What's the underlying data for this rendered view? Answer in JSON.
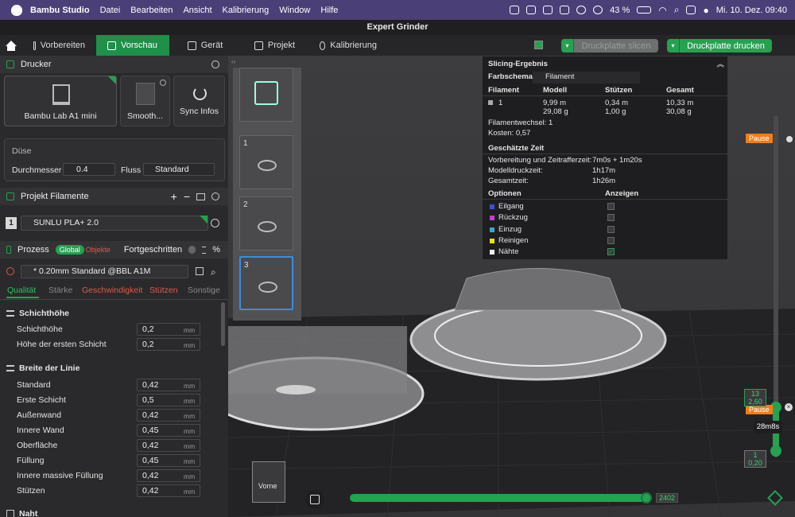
{
  "menubar": {
    "app": "Bambu Studio",
    "items": [
      "Datei",
      "Bearbeiten",
      "Ansicht",
      "Kalibrierung",
      "Window",
      "Hilfe"
    ],
    "battery": "43 %",
    "clock": "Mi. 10. Dez.  09:40"
  },
  "window": {
    "title": "Expert Grinder"
  },
  "tabs": {
    "prepare": "Vorbereiten",
    "preview": "Vorschau",
    "device": "Gerät",
    "project": "Projekt",
    "calibration": "Kalibrierung"
  },
  "actions": {
    "slice": "Druckplatte slicen",
    "print": "Druckplatte drucken"
  },
  "printer": {
    "header": "Drucker",
    "name": "Bambu Lab A1 mini",
    "plate": "Smooth...",
    "sync": "Sync Infos",
    "nozzle_label": "Düse",
    "diameter_label": "Durchmesser",
    "diameter": "0.4",
    "flow_label": "Fluss",
    "flow": "Standard"
  },
  "filament": {
    "header": "Projekt Filamente",
    "index": "1",
    "name": "SUNLU PLA+ 2.0"
  },
  "process": {
    "header": "Prozess",
    "global": "Global",
    "objects": "Objekte",
    "advanced": "Fortgeschritten",
    "preset": "* 0.20mm Standard @BBL A1M"
  },
  "subtabs": [
    "Qualität",
    "Stärke",
    "Geschwindigkeit",
    "Stützen",
    "Sonstige"
  ],
  "groups": {
    "layer_height": "Schichthöhe",
    "line_width": "Breite der Linie",
    "seam": "Naht"
  },
  "layer_rows": [
    {
      "label": "Schichthöhe",
      "value": "0,2",
      "unit": "mm"
    },
    {
      "label": "Höhe der ersten Schicht",
      "value": "0,2",
      "unit": "mm"
    }
  ],
  "width_rows": [
    {
      "label": "Standard",
      "value": "0,42",
      "unit": "mm"
    },
    {
      "label": "Erste Schicht",
      "value": "0,5",
      "unit": "mm"
    },
    {
      "label": "Außenwand",
      "value": "0,42",
      "unit": "mm"
    },
    {
      "label": "Innere Wand",
      "value": "0,45",
      "unit": "mm"
    },
    {
      "label": "Oberfläche",
      "value": "0,42",
      "unit": "mm"
    },
    {
      "label": "Füllung",
      "value": "0,45",
      "unit": "mm"
    },
    {
      "label": "Innere massive Füllung",
      "value": "0,42",
      "unit": "mm"
    },
    {
      "label": "Stützen",
      "value": "0,42",
      "unit": "mm"
    }
  ],
  "thumbs": [
    "1",
    "2",
    "3"
  ],
  "result": {
    "title": "Slicing-Ergebnis",
    "scheme_label": "Farbschema",
    "scheme": "Filament",
    "cols": [
      "Filament",
      "Modell",
      "Stützen",
      "Gesamt"
    ],
    "row": {
      "id": "1",
      "model_m": "9,99 m",
      "model_g": "29,08 g",
      "support_m": "0,34 m",
      "support_g": "1,00 g",
      "total_m": "10,33 m",
      "total_g": "30,08 g"
    },
    "changes": "Filamentwechsel:  1",
    "cost": "Kosten:  0,57",
    "time_title": "Geschätzte Zeit",
    "times": [
      {
        "k": "Vorbereitung und Zeitrafferzeit:",
        "v": "7m0s + 1m20s"
      },
      {
        "k": "Modelldruckzeit:",
        "v": "1h17m"
      },
      {
        "k": "Gesamtzeit:",
        "v": "1h26m"
      }
    ],
    "options_label": "Optionen",
    "show_label": "Anzeigen",
    "options": [
      {
        "name": "Eilgang",
        "color": "#3f4fcf"
      },
      {
        "name": "Rückzug",
        "color": "#c23fcf"
      },
      {
        "name": "Einzug",
        "color": "#3fa6cf"
      },
      {
        "name": "Reinigen",
        "color": "#e6e600"
      },
      {
        "name": "Nähte",
        "color": "#eeeeee"
      }
    ]
  },
  "slider": {
    "pause_top": "Pause",
    "pause_mid": "Pause",
    "layer_top": "13",
    "height_top": "2,60",
    "time": "28m8s",
    "layer_bottom": "1",
    "height_bottom": "0,20"
  },
  "bottom": {
    "view": "Vorne",
    "move_count": "2402"
  }
}
